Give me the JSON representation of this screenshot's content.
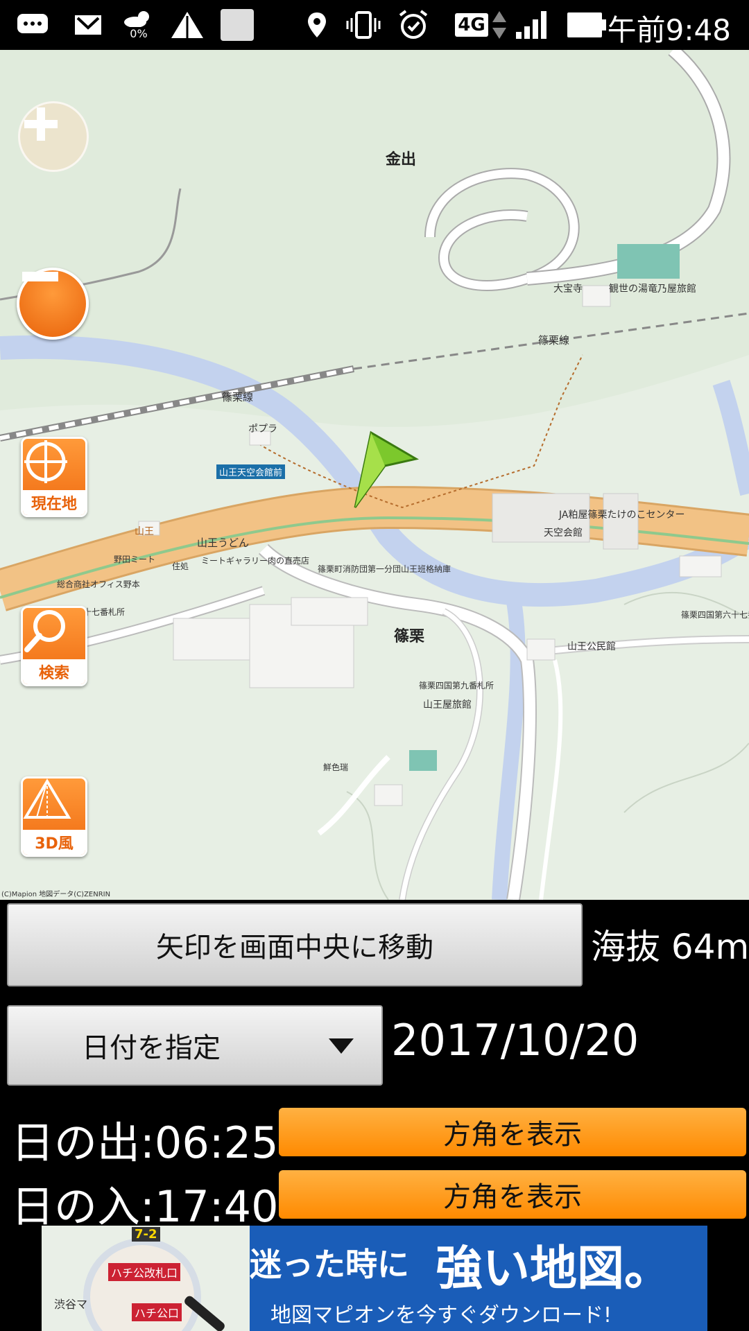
{
  "status_bar": {
    "time": "午前9:48",
    "network": "4G",
    "weather_percent": "0%",
    "icons": [
      "chat-icon",
      "gmail-icon",
      "weather-icon",
      "signal-triangle-icon",
      "square-icon",
      "location-icon",
      "vibrate-icon",
      "alarm-icon",
      "network-4g-icon",
      "cell-signal-icon",
      "battery-icon"
    ]
  },
  "map": {
    "labels": {
      "kanade": "金出",
      "shinoguri": "篠栗",
      "line1": "篠栗線",
      "line2": "篠栗線",
      "poplar": "ポプラ",
      "station": "山王天空会館前",
      "sanno": "山王",
      "sanno_udon": "山王うどん",
      "noda_meat": "野田ミート",
      "sumire": "住処",
      "meat_gallery": "ミートギャラリー肉の直売店",
      "sogo_office": "総合商社オフィス野本",
      "jushichi": "十七番札所",
      "fire_dept": "篠栗町消防団第一分団山王班格納庫",
      "taihoji": "大宝寺",
      "kanze": "観世の湯竜乃屋旅館",
      "ja": "JA粕屋篠栗たけのこセンター",
      "tenku": "天空会館",
      "sanno_kominkan": "山王公民館",
      "shikoku9": "篠栗四国第九番札所",
      "sanno_ryokan": "山王屋旅館",
      "senshoku": "鮮色瑞",
      "shikoku17": "篠栗四国第六十七番"
    },
    "copyright": "(C)Mapion 地図データ(C)ZENRIN"
  },
  "side_buttons": {
    "current_location": "現在地",
    "search": "検索",
    "view3d": "3D風"
  },
  "panel": {
    "center_button": "矢印を画面中央に移動",
    "altitude": "海抜 64m",
    "date_button": "日付を指定",
    "date_value": "2017/10/20",
    "sunrise": "日の出:06:25",
    "sunset": "日の入:17:40",
    "direction_button_1": "方角を表示",
    "direction_button_2": "方角を表示"
  },
  "ad": {
    "headline_small": "迷った時に",
    "headline_big": "強い地図。",
    "subline": "地図マピオンを今すぐダウンロード!",
    "map_labels": [
      "ハチ公改札口",
      "ハチ公口",
      "渋谷マ",
      "7-2"
    ]
  },
  "colors": {
    "orange_accent": "#ff8a00",
    "map_bg": "#e7efe4",
    "road_main": "#f2c285",
    "river": "#c3d2ee",
    "ad_blue": "#1a5db8"
  }
}
